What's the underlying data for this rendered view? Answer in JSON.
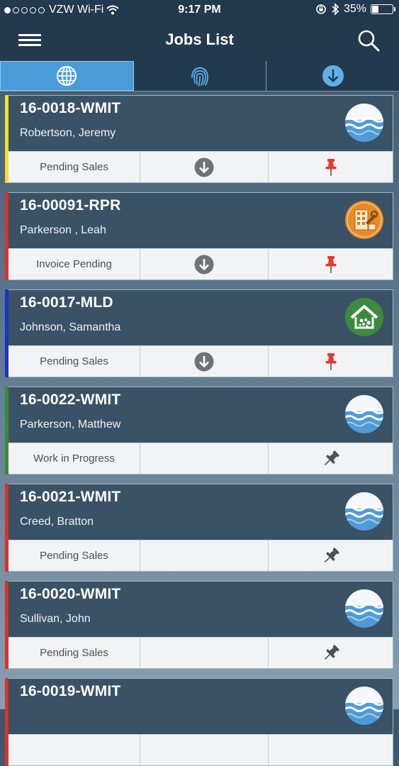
{
  "status_bar": {
    "carrier": "VZW Wi-Fi",
    "signal_bars": [
      true,
      false,
      false,
      false,
      false
    ],
    "time": "9:17 PM",
    "battery": "35%",
    "battery_level": 0.35
  },
  "nav": {
    "title": "Jobs List"
  },
  "tabs": [
    {
      "icon": "globe-icon",
      "active": true
    },
    {
      "icon": "fingerprint-icon",
      "active": false
    },
    {
      "icon": "download-circle-icon",
      "active": false
    }
  ],
  "colors": {
    "accent_yellow": "#f1e12a",
    "accent_red": "#d9322c",
    "accent_blue": "#1b34c4",
    "accent_green": "#3d8a35",
    "pin_red": "#e63a2e",
    "pin_gray": "#4a4f55",
    "water_blue": "#4f9bd6",
    "building_orange": "#e58c2a",
    "mold_green": "#3c8a40"
  },
  "jobs": [
    {
      "id": "16-0018-WMIT",
      "client": "Robertson, Jeremy",
      "status": "Pending Sales",
      "accent": "#f1e12a",
      "icon": "water-icon",
      "download": true,
      "pin": "red"
    },
    {
      "id": "16-00091-RPR",
      "client": "Parkerson , Leah",
      "status": "Invoice Pending",
      "accent": "#d9322c",
      "icon": "building-repair-icon",
      "download": true,
      "pin": "red"
    },
    {
      "id": "16-0017-MLD",
      "client": "Johnson, Samantha",
      "status": "Pending Sales",
      "accent": "#1b34c4",
      "icon": "mold-house-icon",
      "download": true,
      "pin": "red"
    },
    {
      "id": "16-0022-WMIT",
      "client": "Parkerson, Matthew",
      "status": "Work in Progress",
      "accent": "#3d8a35",
      "icon": "water-icon",
      "download": false,
      "pin": "gray"
    },
    {
      "id": "16-0021-WMIT",
      "client": "Creed, Bratton",
      "status": "Pending Sales",
      "accent": "#d9322c",
      "icon": "water-icon",
      "download": false,
      "pin": "gray"
    },
    {
      "id": "16-0020-WMIT",
      "client": "Sullivan, John",
      "status": "Pending Sales",
      "accent": "#d9322c",
      "icon": "water-icon",
      "download": false,
      "pin": "gray"
    },
    {
      "id": "16-0019-WMIT",
      "client": "",
      "status": "",
      "accent": "#d9322c",
      "icon": "water-icon",
      "download": false,
      "pin": "none"
    }
  ]
}
